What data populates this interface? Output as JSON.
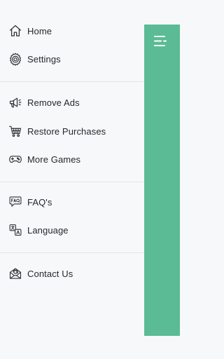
{
  "drawer": {
    "sections": [
      {
        "items": [
          {
            "name": "home",
            "icon": "home-icon",
            "label": "Home"
          },
          {
            "name": "settings",
            "icon": "settings-gear-icon",
            "label": "Settings"
          }
        ]
      },
      {
        "items": [
          {
            "name": "remove-ads",
            "icon": "megaphone-icon",
            "label": "Remove Ads"
          },
          {
            "name": "restore-purchases",
            "icon": "shopping-cart-icon",
            "label": "Restore Purchases"
          },
          {
            "name": "more-games",
            "icon": "gamepad-icon",
            "label": "More Games"
          }
        ]
      },
      {
        "items": [
          {
            "name": "faqs",
            "icon": "faq-chat-icon",
            "label": "FAQ's"
          },
          {
            "name": "language",
            "icon": "translate-icon",
            "label": "Language"
          }
        ]
      },
      {
        "items": [
          {
            "name": "contact-us",
            "icon": "mail-contact-icon",
            "label": "Contact Us"
          }
        ]
      }
    ]
  },
  "side_panel": {
    "color": "#5bbb95",
    "menu_icon": "menu-icon"
  },
  "colors": {
    "background": "#f7f8fa",
    "text": "#24282c",
    "divider": "#e3e6ea",
    "accent": "#5bbb95"
  }
}
